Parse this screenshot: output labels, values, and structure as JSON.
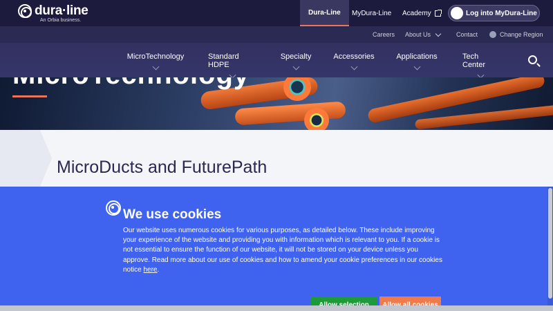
{
  "brand": {
    "name": "dura·line",
    "tagline": "An Orbia business."
  },
  "topbar": {
    "tabs": [
      {
        "label": "Dura-Line"
      },
      {
        "label": "MyDura-Line"
      },
      {
        "label": "Academy"
      }
    ],
    "login_label": "Log into MyDura-Line"
  },
  "utility": {
    "careers": "Careers",
    "about": "About Us",
    "contact": "Contact",
    "region": "Change Region"
  },
  "nav": {
    "items": [
      {
        "label": "MicroTechnology"
      },
      {
        "label": "Standard HDPE"
      },
      {
        "label": "Specialty"
      },
      {
        "label": "Accessories"
      },
      {
        "label": "Applications"
      },
      {
        "label": "Tech Center"
      }
    ]
  },
  "hero": {
    "title": "MicroTechnology"
  },
  "content": {
    "title": "MicroDucts and FuturePath"
  },
  "cookie": {
    "title": "We use cookies",
    "text": "Our website uses numerous cookies for various purposes, as detailed below. These include improving your experience of the website and providing you with information which is relevant to you. If a cookie is not essential to ensure the function of our website, it will not be stored on your device unless you approve. Read more about our use of cookies and how to amend your cookie preferences in our cookies notice ",
    "link": "here",
    "period": ".",
    "allow_selection": "Allow selection",
    "allow_all": "Allow all cookies"
  },
  "colors": {
    "topbar": "#1d1b3d",
    "nav": "#323160",
    "cookie_bg": "#3f63ef",
    "accent": "#e8765c",
    "allow_selection": "#1e9a3a",
    "allow_all": "#f07a4a"
  }
}
